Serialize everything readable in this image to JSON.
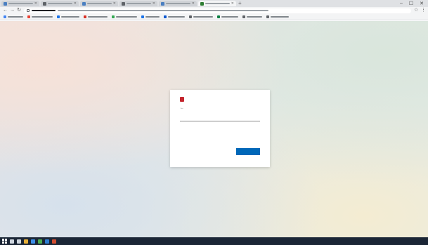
{
  "browser": {
    "tabs": [
      {
        "title": "",
        "favicon_color": "#4a7fc1",
        "active": false
      },
      {
        "title": "",
        "favicon_color": "#5f6368",
        "active": false
      },
      {
        "title": "",
        "favicon_color": "#4a7fc1",
        "active": false
      },
      {
        "title": "",
        "favicon_color": "#5f6368",
        "active": false
      },
      {
        "title": "",
        "favicon_color": "#4a7fc1",
        "active": false
      },
      {
        "title": "",
        "favicon_color": "#2e7d32",
        "active": true
      }
    ],
    "address": {
      "url": ""
    },
    "bookmarks": [
      {
        "label": "",
        "color": "#4285f4"
      },
      {
        "label": "",
        "color": "#ea4335"
      },
      {
        "label": "",
        "color": "#1a73e8"
      },
      {
        "label": "",
        "color": "#d93025"
      },
      {
        "label": "",
        "color": "#34a853"
      },
      {
        "label": "",
        "color": "#1a73e8"
      },
      {
        "label": "",
        "color": "#0b57d0"
      },
      {
        "label": "",
        "color": "#5f6368"
      },
      {
        "label": "",
        "color": "#0b8043"
      },
      {
        "label": "",
        "color": "#5f6368"
      },
      {
        "label": "",
        "color": "#5f6368"
      }
    ]
  },
  "signin": {
    "logo_color": "#c4262e",
    "account": "",
    "heading": "",
    "password_placeholder": "",
    "forgot_link": "",
    "signin_button": "",
    "button_color": "#0067b8"
  },
  "footer": {
    "links": [
      "",
      ""
    ]
  },
  "taskbar": {
    "icons": [
      {
        "name": "search-icon",
        "color": "#cfd6df"
      },
      {
        "name": "task-view-icon",
        "color": "#cfd6df"
      },
      {
        "name": "file-explorer-icon",
        "color": "#e8b13a"
      },
      {
        "name": "browser-icon",
        "color": "#3d8ee8"
      },
      {
        "name": "app-icon",
        "color": "#4caf50"
      },
      {
        "name": "app-icon",
        "color": "#2d7dd2"
      },
      {
        "name": "app-icon",
        "color": "#d04d2f"
      }
    ],
    "time": "",
    "date": ""
  }
}
